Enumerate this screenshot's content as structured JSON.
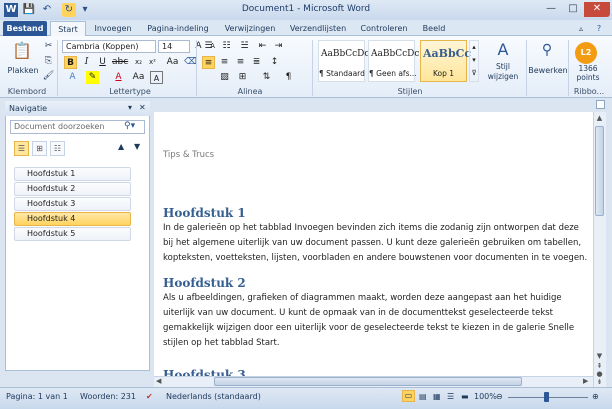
{
  "window": {
    "title": "Document1 - Microsoft Word",
    "minimize": "—",
    "maximize": "□",
    "close": "✕"
  },
  "quick_access": {
    "word_icon": "W",
    "save": "💾",
    "undo": "↶",
    "redo": "↻",
    "customize": "▾"
  },
  "tabs": [
    "Bestand",
    "Start",
    "Invoegen",
    "Pagina-indeling",
    "Verwijzingen",
    "Verzendlijsten",
    "Controleren",
    "Beeld"
  ],
  "ribbon": {
    "clipboard": {
      "paste_label": "Plakken",
      "group_label": "Klembord"
    },
    "font": {
      "font_name": "Cambria (Koppen)",
      "font_size": "14",
      "group_label": "Lettertype"
    },
    "paragraph": {
      "group_label": "Alinea"
    },
    "styles": {
      "group_label": "Stijlen",
      "items": [
        {
          "sample": "AaBbCcDc",
          "name": "¶ Standaard"
        },
        {
          "sample": "AaBbCcDc",
          "name": "¶ Geen afs..."
        },
        {
          "sample": "AaBbCc",
          "name": "Kop 1"
        }
      ],
      "change_label": "Stijl wijzigen"
    },
    "edit": {
      "label": "Bewerken"
    },
    "ribbit": {
      "badge": "L2",
      "points": "1366 points",
      "group_label": "Ribbo..."
    }
  },
  "navigation": {
    "title": "Navigatie",
    "search_placeholder": "Document doorzoeken",
    "items": [
      "Hoofdstuk 1",
      "Hoofdstuk 2",
      "Hoofdstuk 3",
      "Hoofdstuk 4",
      "Hoofdstuk 5"
    ],
    "selected_index": 3
  },
  "document": {
    "header": "Tips & Trucs",
    "sections": [
      {
        "heading": "Hoofdstuk 1",
        "body": "In de galerieën op het tabblad Invoegen bevinden zich items die zodanig zijn ontworpen dat deze bij het algemene uiterlijk van uw document passen. U kunt deze galerieën gebruiken om tabellen, kopteksten, voetteksten, lijsten, voorbladen en andere bouwstenen voor documenten in te voegen."
      },
      {
        "heading": "Hoofdstuk 2",
        "body": "Als u afbeeldingen, grafieken of diagrammen maakt, worden deze aangepast aan het huidige uiterlijk van uw document. U kunt de opmaak van in de documenttekst geselecteerde tekst gemakkelijk wijzigen door een uiterlijk voor de geselecteerde tekst te kiezen in de galerie Snelle stijlen op het tabblad Start."
      },
      {
        "heading": "Hoofdstuk 3",
        "body": ""
      }
    ]
  },
  "status": {
    "page": "Pagina: 1 van 1",
    "words": "Woorden: 231",
    "language": "Nederlands (standaard)",
    "zoom": "100%"
  },
  "colors": {
    "accent": "#2b5797",
    "heading": "#365f91",
    "selected_nav": "#ffd35e"
  }
}
